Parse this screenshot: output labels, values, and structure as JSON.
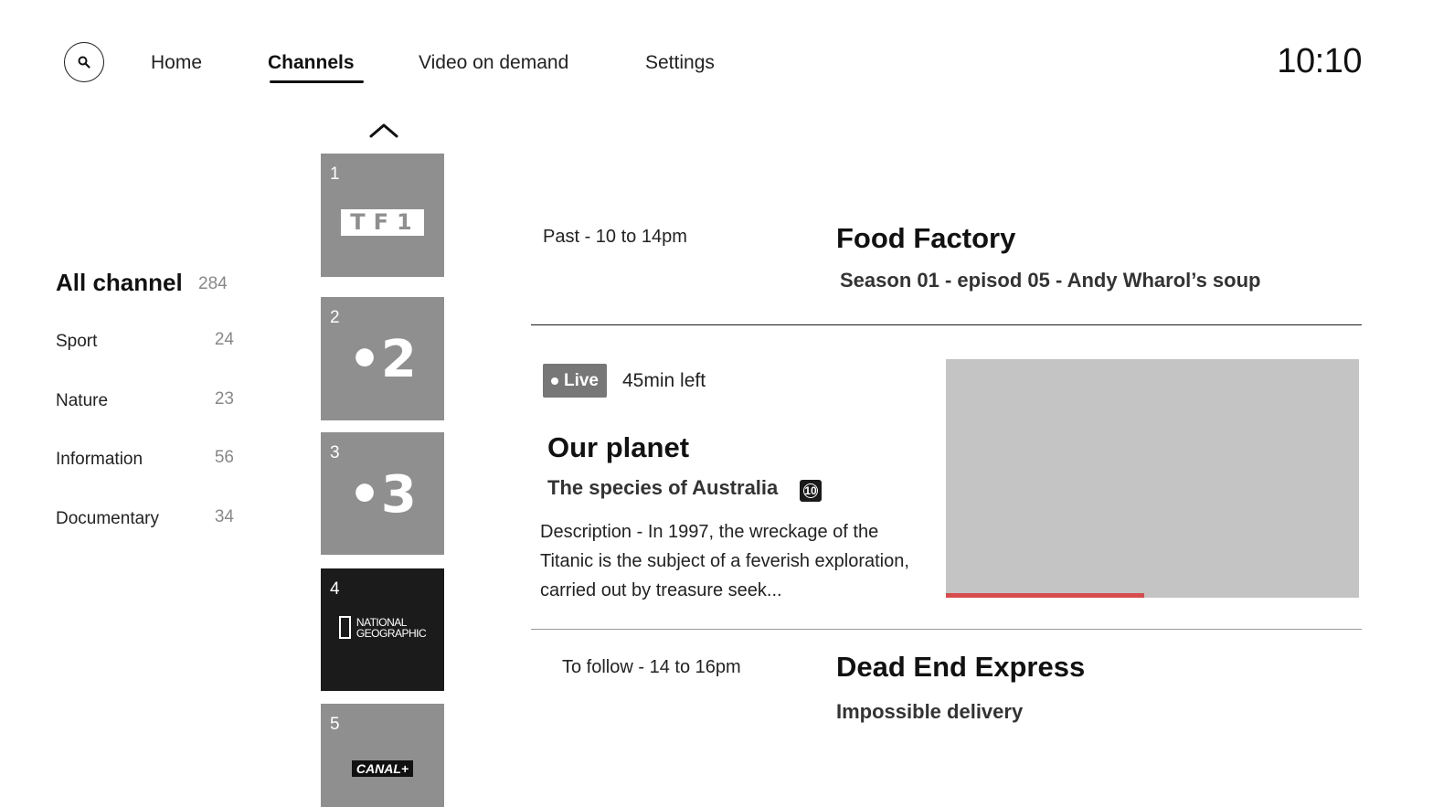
{
  "header": {
    "nav": [
      {
        "label": "Home",
        "active": false
      },
      {
        "label": "Channels",
        "active": true
      },
      {
        "label": "Video on demand",
        "active": false
      },
      {
        "label": "Settings",
        "active": false
      }
    ],
    "clock": "10:10",
    "search_icon": "search-icon"
  },
  "categories": {
    "title": "All channel",
    "total": "284",
    "items": [
      {
        "label": "Sport",
        "count": "24"
      },
      {
        "label": "Nature",
        "count": "23"
      },
      {
        "label": "Information",
        "count": "56"
      },
      {
        "label": "Documentary",
        "count": "34"
      }
    ]
  },
  "channels": [
    {
      "number": "1",
      "logo": "TF1"
    },
    {
      "number": "2",
      "logo": "•2"
    },
    {
      "number": "3",
      "logo": "•3"
    },
    {
      "number": "4",
      "logo_line1": "NATIONAL",
      "logo_line2": "GEOGRAPHIC"
    },
    {
      "number": "5",
      "logo": "CANAL+"
    }
  ],
  "program": {
    "past": {
      "time": "Past - 10 to 14pm",
      "title": "Food Factory",
      "subtitle": "Season 01 - episod 05 - Andy Wharol’s soup"
    },
    "live": {
      "badge": "Live",
      "remaining": "45min left",
      "title": "Our planet",
      "subtitle": "The species of Australia",
      "rating": "10",
      "description": "Description - In 1997, the wreckage of the Titanic is the subject of a feverish exploration, carried out by treasure seek...",
      "progress": 0.48
    },
    "next": {
      "time": "To follow - 14 to 16pm",
      "title": "Dead End Express",
      "subtitle": "Impossible delivery"
    }
  },
  "colors": {
    "progress": "#d64b4b",
    "tile": "#8f8f8f",
    "tile_dark": "#1b1b1b",
    "preview": "#c4c4c4"
  }
}
